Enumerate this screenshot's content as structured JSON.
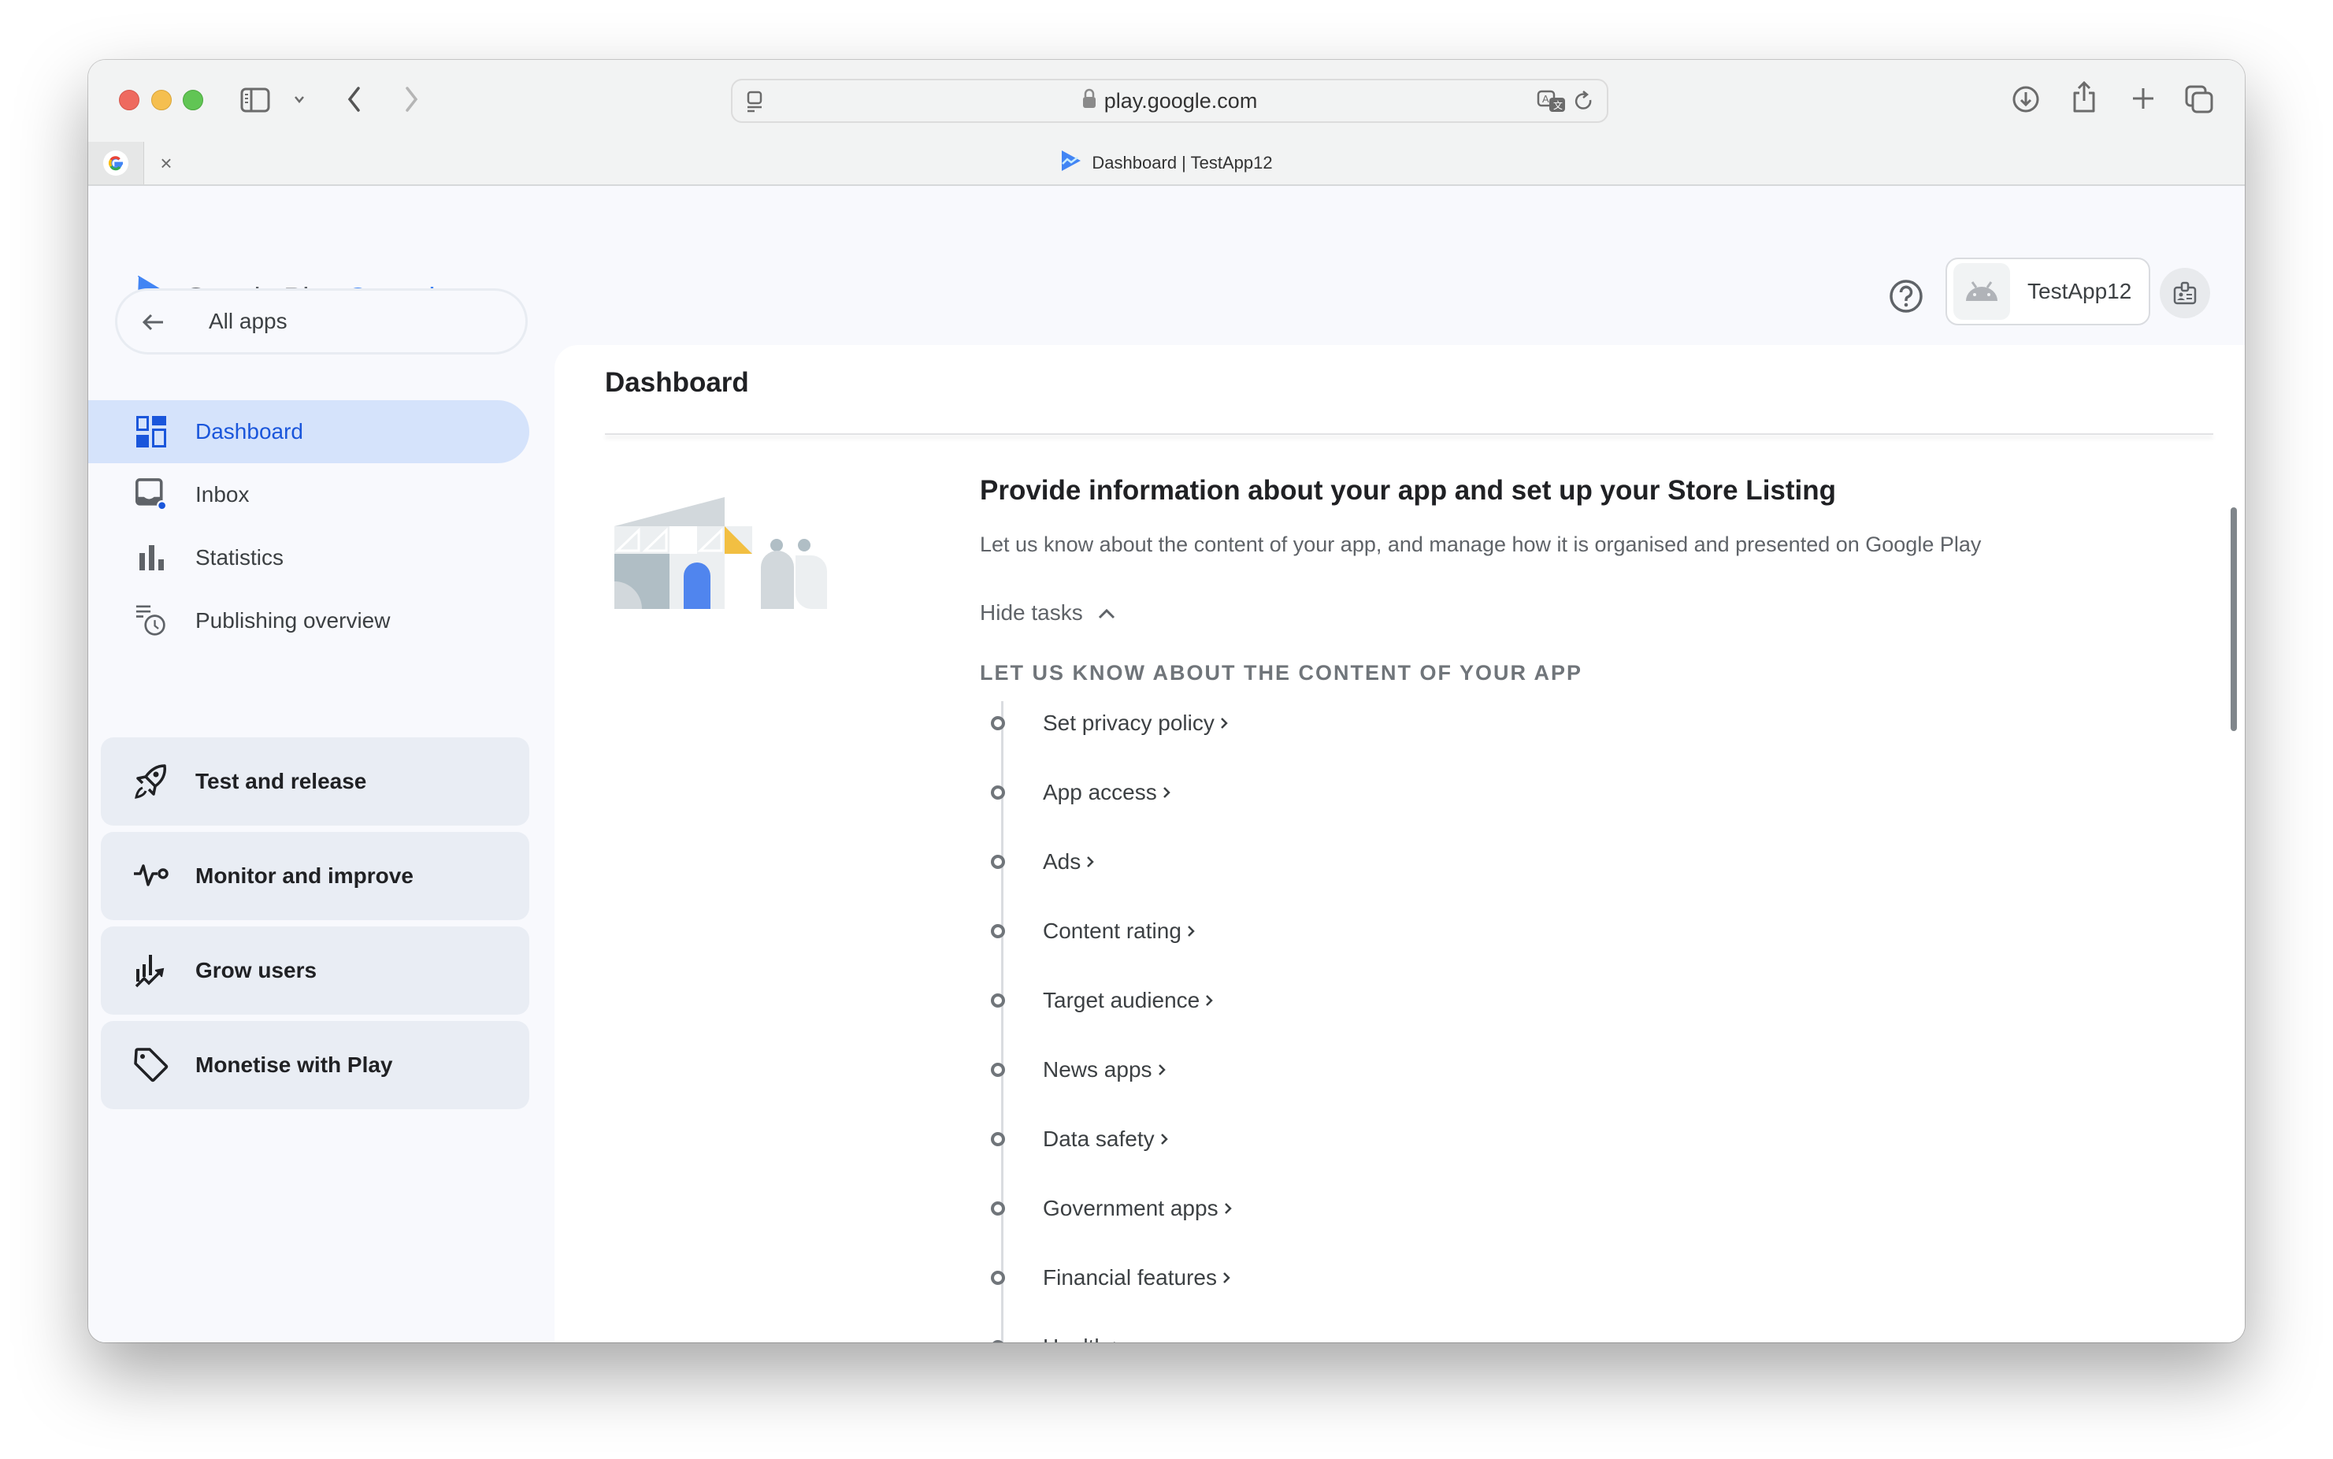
{
  "browser": {
    "url": "play.google.com",
    "tab_title": "Dashboard | TestApp12",
    "icons": {
      "sidebar_toggle": "sidebar-icon",
      "back": "chevron-left-icon",
      "forward": "chevron-right-icon",
      "reader": "reader-icon",
      "lock": "lock-icon",
      "translate": "translate-icon",
      "reload": "reload-icon",
      "download": "download-icon",
      "share": "share-icon",
      "new_tab": "plus-icon",
      "tabs_overview": "tabs-icon",
      "tab_close": "×"
    }
  },
  "header": {
    "logo_main": "Google Play",
    "logo_accent": "Console",
    "app_name": "TestApp12"
  },
  "sidebar": {
    "all_apps": "All apps",
    "items": [
      {
        "label": "Dashboard",
        "icon": "dashboard-icon",
        "active": true
      },
      {
        "label": "Inbox",
        "icon": "inbox-icon",
        "badge": true
      },
      {
        "label": "Statistics",
        "icon": "bar-chart-icon"
      },
      {
        "label": "Publishing overview",
        "icon": "publishing-icon"
      }
    ],
    "groups": [
      {
        "label": "Test and release",
        "icon": "rocket-icon"
      },
      {
        "label": "Monitor and improve",
        "icon": "vitals-icon"
      },
      {
        "label": "Grow users",
        "icon": "growth-icon"
      },
      {
        "label": "Monetise with Play",
        "icon": "tag-icon"
      }
    ]
  },
  "main": {
    "title": "Dashboard",
    "card": {
      "heading": "Provide information about your app and set up your Store Listing",
      "description": "Let us know about the content of your app, and manage how it is organised and presented on Google Play",
      "toggle_label": "Hide tasks",
      "section_label": "LET US KNOW ABOUT THE CONTENT OF YOUR APP",
      "tasks": [
        "Set privacy policy",
        "App access",
        "Ads",
        "Content rating",
        "Target audience",
        "News apps",
        "Data safety",
        "Government apps",
        "Financial features",
        "Health"
      ]
    }
  },
  "colors": {
    "accent": "#1a56db",
    "active_nav_bg": "#d5e3fb",
    "group_bg": "#e9edf4",
    "logo_blue": "#4285f4"
  }
}
